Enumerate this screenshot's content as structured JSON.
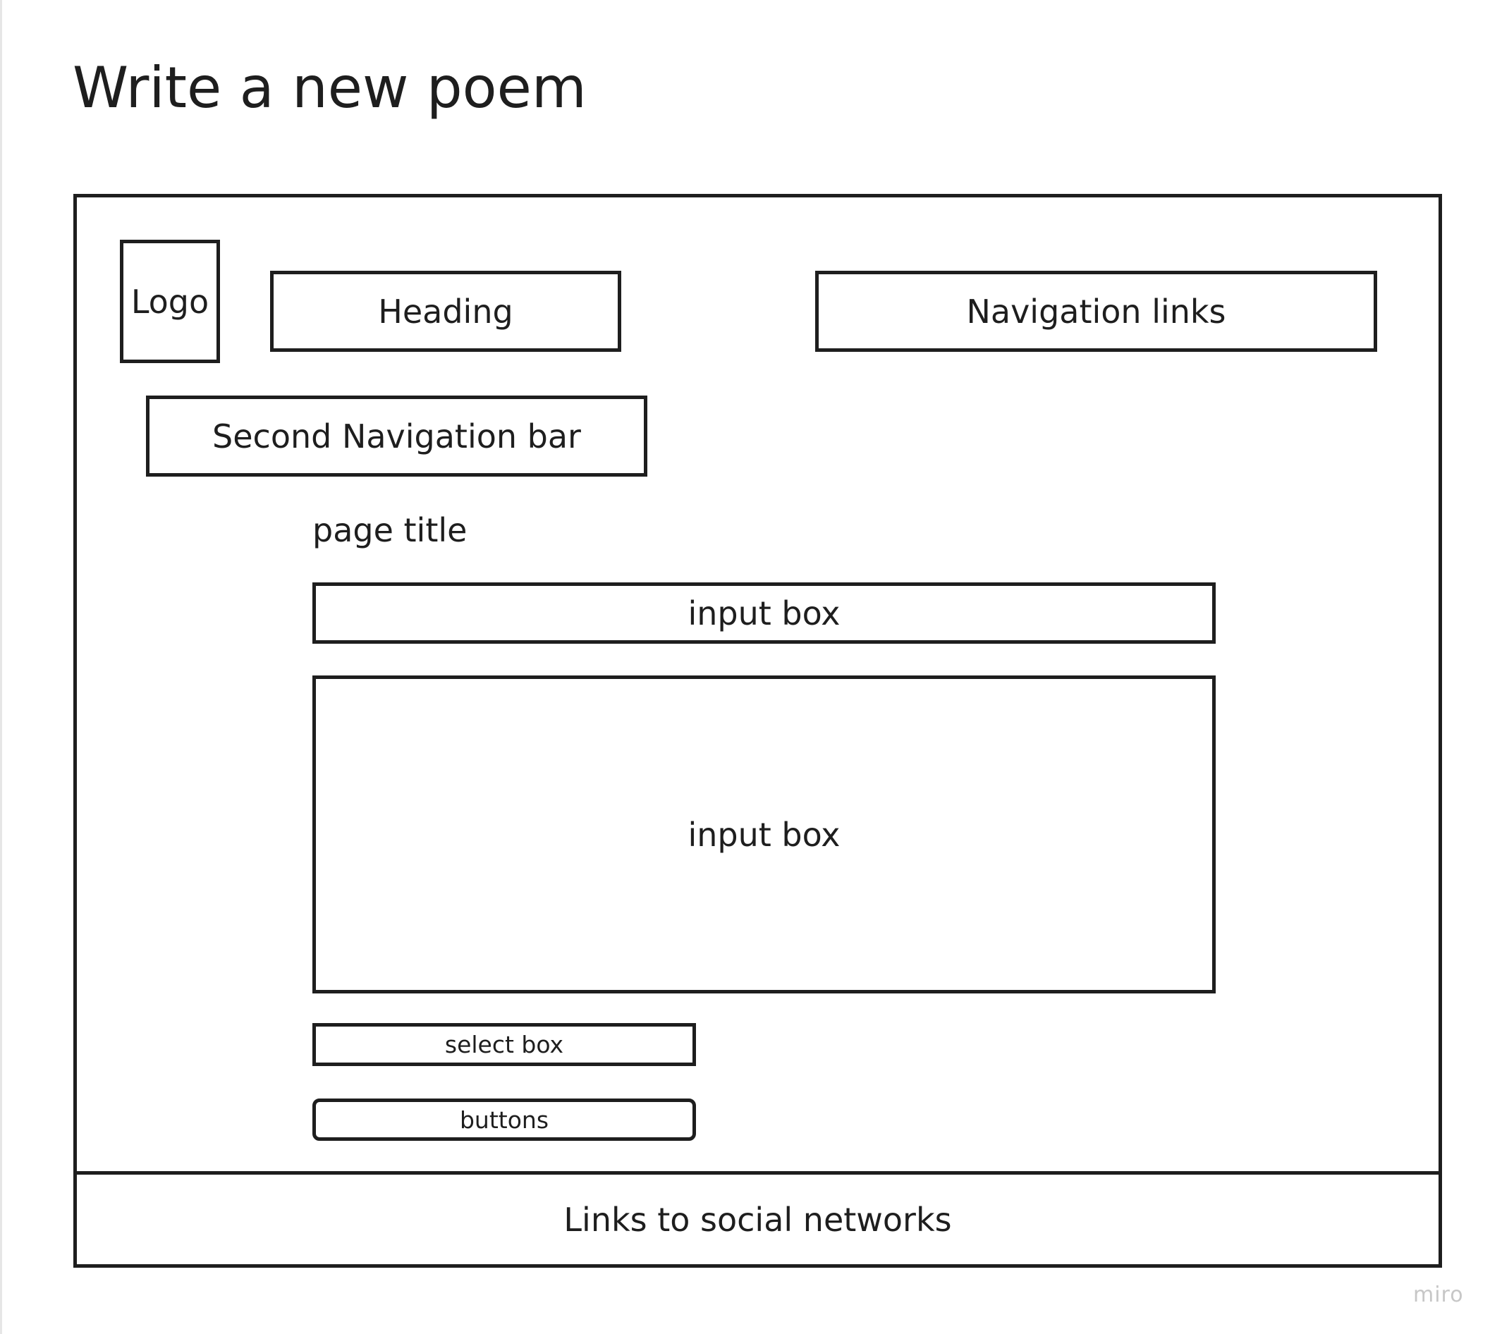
{
  "board": {
    "title": "Write a new poem"
  },
  "wireframe": {
    "logo": "Logo",
    "heading": "Heading",
    "navigation_links": "Navigation links",
    "second_navigation_bar": "Second Navigation bar",
    "page_title": "page title",
    "input_box_title": "input box",
    "input_box_body": "input box",
    "select_box": "select box",
    "buttons": "buttons",
    "footer": "Links to social networks"
  },
  "watermark": "miro"
}
